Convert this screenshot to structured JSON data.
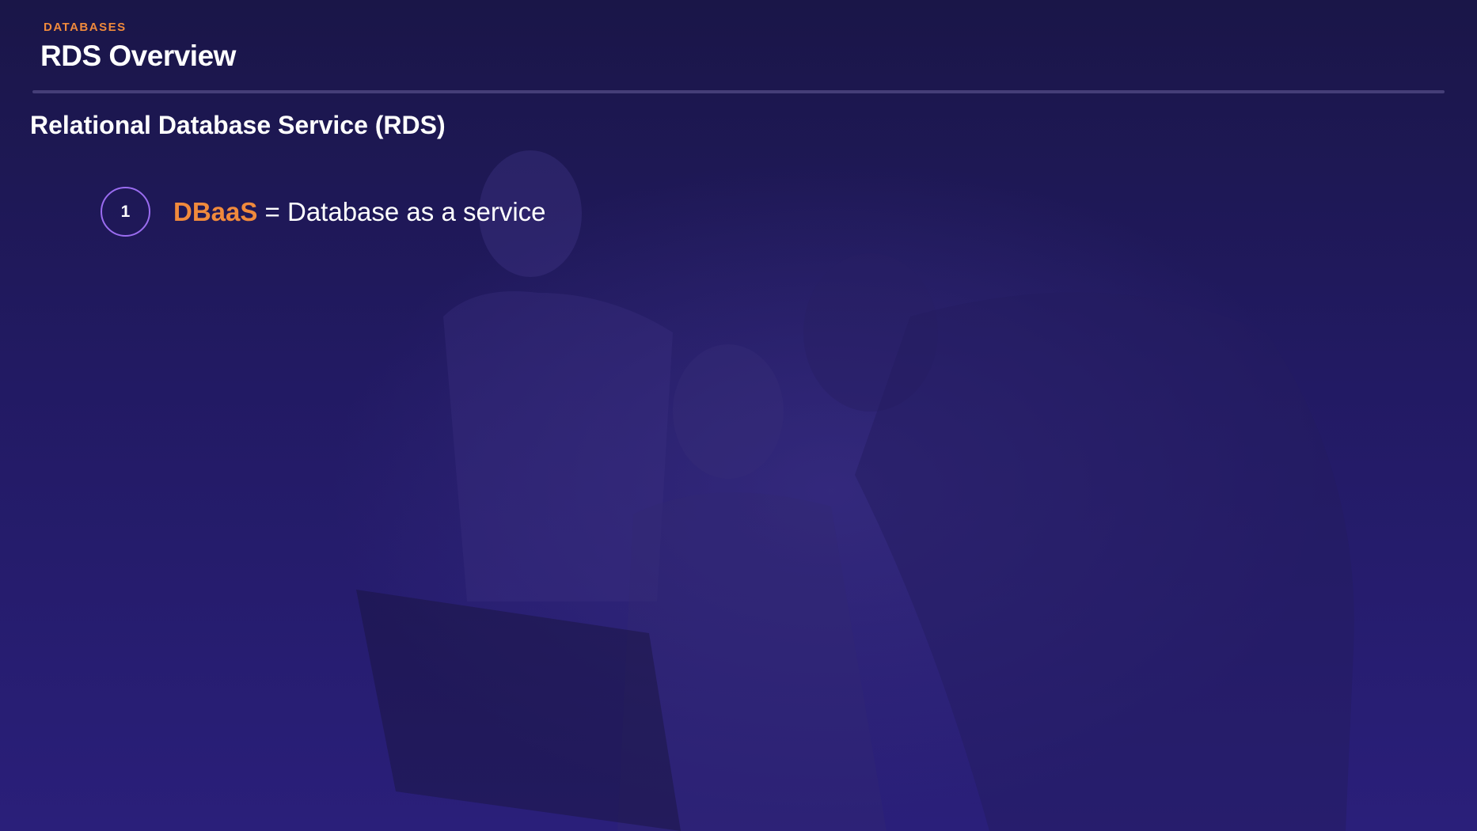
{
  "header": {
    "eyebrow": "DATABASES",
    "title": "RDS Overview"
  },
  "section": {
    "subtitle": "Relational Database Service (RDS)"
  },
  "items": [
    {
      "number": "1",
      "term": "DBaaS",
      "description": " = Database as a service"
    }
  ],
  "colors": {
    "accent": "#f08a3c",
    "background": "#1e1852",
    "circle_border": "#9a6cf0",
    "text": "#ffffff"
  }
}
